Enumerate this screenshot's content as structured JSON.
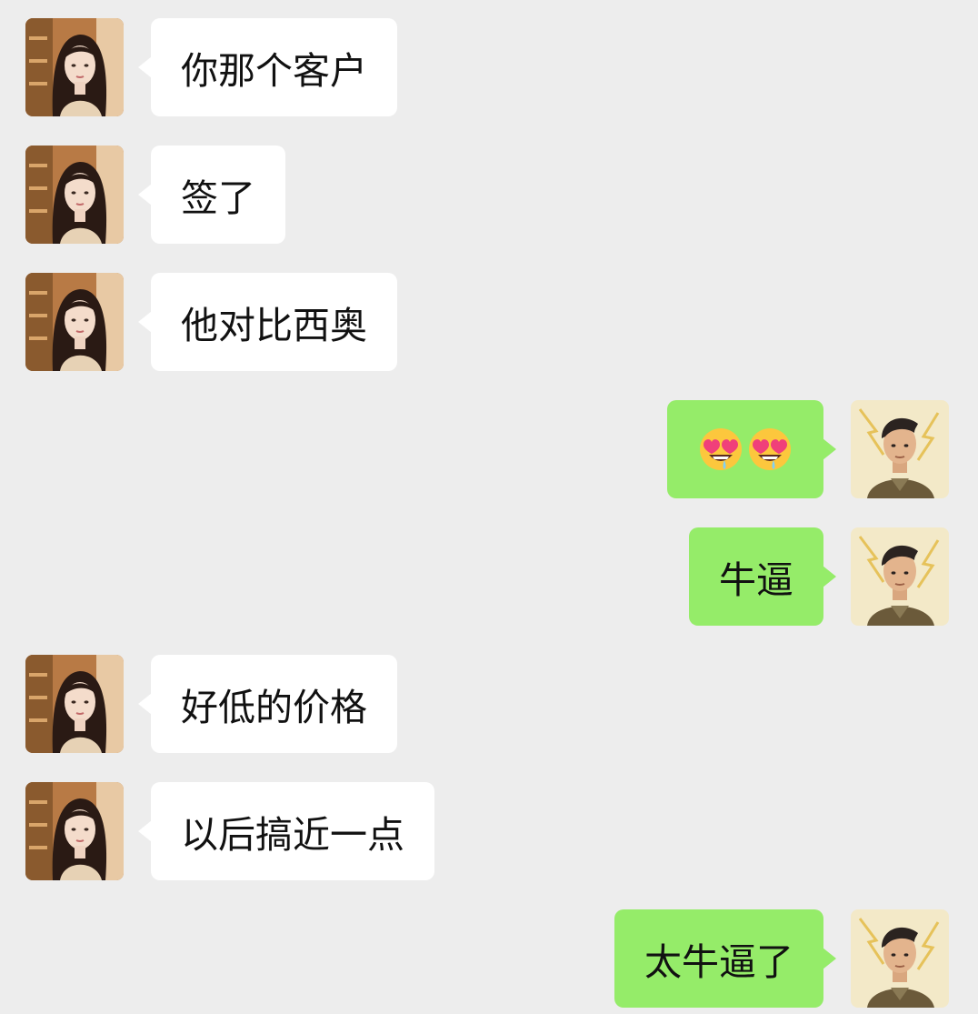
{
  "messages": [
    {
      "side": "left",
      "text": "你那个客户"
    },
    {
      "side": "left",
      "text": "签了"
    },
    {
      "side": "left",
      "text": "他对比西奥"
    },
    {
      "side": "right",
      "text": "😍😍",
      "emoji": [
        "heart-eyes-drooling-face",
        "heart-eyes-drooling-face"
      ]
    },
    {
      "side": "right",
      "text": "牛逼"
    },
    {
      "side": "left",
      "text": "好低的价格"
    },
    {
      "side": "left",
      "text": "以后搞近一点"
    },
    {
      "side": "right",
      "text": "太牛逼了"
    }
  ],
  "colors": {
    "background": "#ededed",
    "incoming_bubble": "#ffffff",
    "outgoing_bubble": "#95ec69"
  },
  "icons": {
    "incoming_avatar": "woman-portrait-avatar",
    "outgoing_avatar": "man-illustrated-avatar"
  }
}
